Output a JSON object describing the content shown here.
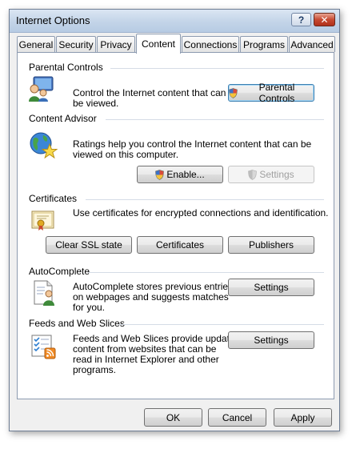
{
  "window": {
    "title": "Internet Options"
  },
  "tabs": [
    {
      "label": "General"
    },
    {
      "label": "Security"
    },
    {
      "label": "Privacy"
    },
    {
      "label": "Content"
    },
    {
      "label": "Connections"
    },
    {
      "label": "Programs"
    },
    {
      "label": "Advanced"
    }
  ],
  "parental": {
    "title": "Parental Controls",
    "desc1": "Control the Internet content that can",
    "desc2": "be viewed.",
    "button": "Parental Controls"
  },
  "advisor": {
    "title": "Content Advisor",
    "desc1": "Ratings help you control the Internet content that can be",
    "desc2": "viewed on this computer.",
    "enable_button": "Enable...",
    "settings_button": "Settings"
  },
  "certificates": {
    "title": "Certificates",
    "desc": "Use certificates for encrypted connections and identification.",
    "clear_ssl_button": "Clear SSL state",
    "certificates_button": "Certificates",
    "publishers_button": "Publishers"
  },
  "autocomplete": {
    "title": "AutoComplete",
    "desc1": "AutoComplete stores previous entries",
    "desc2": "on webpages and suggests matches",
    "desc3": "for you.",
    "settings_button": "Settings"
  },
  "feeds": {
    "title": "Feeds and Web Slices",
    "desc1": "Feeds and Web Slices provide updated",
    "desc2": "content from websites that can be",
    "desc3": "read in Internet Explorer and other",
    "desc4": "programs.",
    "settings_button": "Settings"
  },
  "footer": {
    "ok": "OK",
    "cancel": "Cancel",
    "apply": "Apply"
  },
  "colors": {
    "accent": "#3c7fb1",
    "close": "#c74a32"
  }
}
